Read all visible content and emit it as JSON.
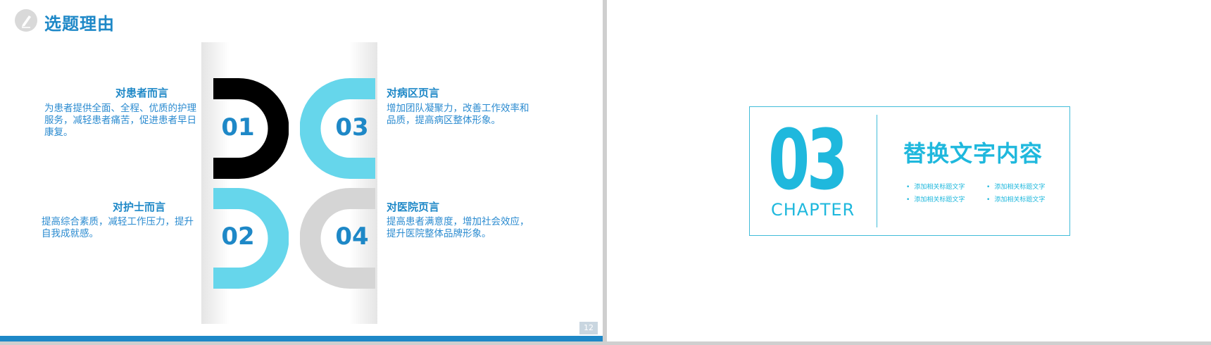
{
  "left_slide": {
    "title": "选题理由",
    "page_number": "12",
    "items": [
      {
        "num": "01",
        "heading": "对患者而言",
        "text": [
          "为患者提供全面、全程、优质的护理",
          "服务，减轻患者痛苦，促进患者早日",
          "康复。"
        ]
      },
      {
        "num": "02",
        "heading": "对护士而言",
        "text": [
          "提高综合素质，减轻工作压力，提升",
          "自我成就感。"
        ]
      },
      {
        "num": "03",
        "heading": "对病区页言",
        "text": [
          "增加团队凝聚力，改善工作效率和",
          "品质，提高病区整体形象。"
        ]
      },
      {
        "num": "04",
        "heading": "对医院页言",
        "text": [
          "提高患者满意度，增加社会效应，",
          "提升医院整体品牌形象。"
        ]
      }
    ]
  },
  "right_slide": {
    "chapter_number": "03",
    "chapter_label": "CHAPTER",
    "title": "替换文字内容",
    "bullets": [
      "添加相关标题文字",
      "添加相关标题文字",
      "添加相关标题文字",
      "添加相关标题文字"
    ]
  },
  "colors": {
    "accent": "#1e88c7",
    "light_cyan": "#66d6eb",
    "black": "#000000",
    "gray": "#d5d5d5",
    "chapter": "#1fb8dd"
  },
  "icons": [
    "pencil-icon"
  ]
}
